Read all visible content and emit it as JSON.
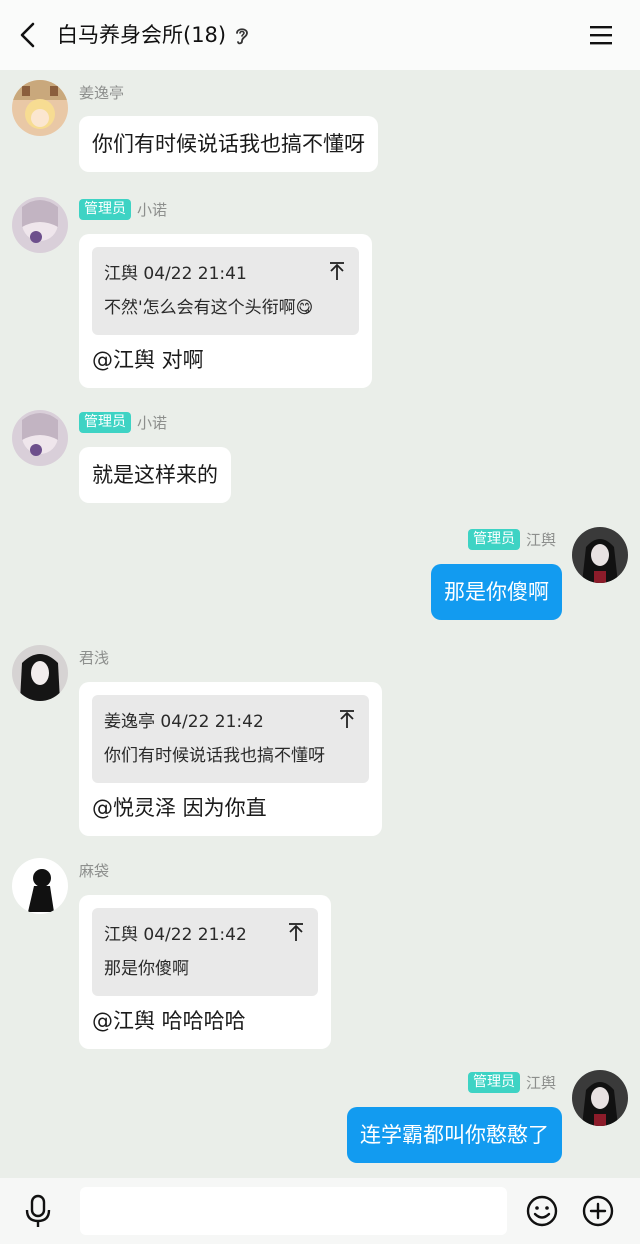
{
  "header": {
    "title": "白马养身会所(18)"
  },
  "messages": [
    {
      "sender": "姜逸亭",
      "admin": false,
      "text": "你们有时候说话我也搞不懂呀"
    },
    {
      "sender": "小诺",
      "admin": true,
      "badge": "管理员",
      "quote": {
        "author": "江舆 04/22 21:41",
        "text": "不然'怎么会有这个头衔啊😋"
      },
      "text": "@江舆 对啊"
    },
    {
      "sender": "小诺",
      "admin": true,
      "badge": "管理员",
      "text": "就是这样来的"
    },
    {
      "sender": "江舆",
      "admin": true,
      "badge": "管理员",
      "mine": true,
      "text": "那是你傻啊"
    },
    {
      "sender": "君浅",
      "admin": false,
      "quote": {
        "author": "姜逸亭 04/22 21:42",
        "text": "你们有时候说话我也搞不懂呀"
      },
      "text": "@悦灵泽 因为你直"
    },
    {
      "sender": "麻袋",
      "admin": false,
      "quote": {
        "author": "江舆 04/22 21:42",
        "text": "那是你傻啊"
      },
      "text": "@江舆 哈哈哈哈"
    },
    {
      "sender": "江舆",
      "admin": true,
      "badge": "管理员",
      "mine": true,
      "text": "连学霸都叫你憨憨了"
    }
  ],
  "input": {
    "value": "",
    "placeholder": ""
  },
  "colors": {
    "background": "#eaeee9",
    "admin_badge": "#3ed3c4",
    "my_bubble": "#129bf0"
  },
  "icons": [
    "back-icon",
    "ear-icon",
    "menu-icon",
    "mic-icon",
    "emoji-icon",
    "plus-icon",
    "pin-up-icon"
  ]
}
